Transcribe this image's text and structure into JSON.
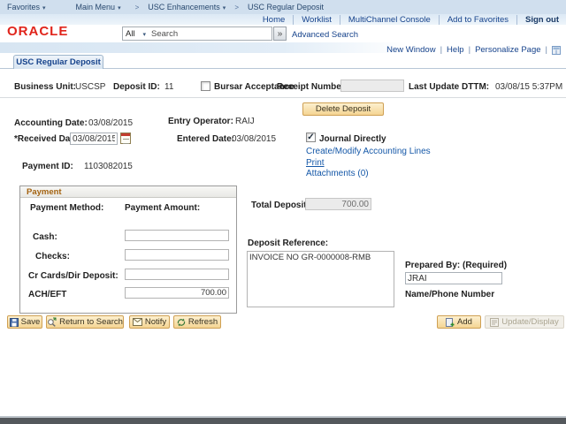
{
  "header": {
    "breadcrumb": {
      "favorites": "Favorites",
      "main_menu": "Main Menu",
      "separator": ">",
      "usc_enhancements": "USC Enhancements",
      "current": "USC Regular Deposit"
    },
    "nav_links": {
      "home": "Home",
      "worklist": "Worklist",
      "multichannel_console": "MultiChannel Console",
      "add_to_favorites": "Add to Favorites",
      "sign_out": "Sign out"
    },
    "logo_text": "ORACLE",
    "search": {
      "scope": "All",
      "placeholder": "Search",
      "advanced_label": "Advanced Search"
    },
    "page_links": {
      "new_window": "New Window",
      "help": "Help",
      "personalize_page": "Personalize Page"
    }
  },
  "tab_label": "USC Regular Deposit",
  "record": {
    "business_unit_label": "Business Unit:",
    "business_unit": "USCSP",
    "deposit_id_label": "Deposit ID:",
    "deposit_id": "11",
    "bursar_acceptance_label": "Bursar Acceptance",
    "bursar_acceptance_checked": false,
    "receipt_number_label": "Receipt Number",
    "receipt_number": "",
    "last_update_label": "Last Update DTTM:",
    "last_update": "03/08/15 5:37PM",
    "accounting_date_label": "Accounting Date:",
    "accounting_date": "03/08/2015",
    "entry_operator_label": "Entry Operator:",
    "entry_operator": "RAIJ",
    "received_date_label": "*Received Date:",
    "received_date": "03/08/2015",
    "entered_date_label": "Entered Date:",
    "entered_date": "03/08/2015",
    "payment_id_label": "Payment ID:",
    "payment_id": "1103082015",
    "journal_directly_label": "Journal Directly",
    "journal_directly_checked": true
  },
  "links": {
    "create_modify": "Create/Modify Accounting Lines",
    "print": "Print",
    "attachments": "Attachments (0)"
  },
  "buttons": {
    "delete_deposit": "Delete Deposit",
    "save": "Save",
    "return_to_search": "Return to Search",
    "notify": "Notify",
    "refresh": "Refresh",
    "add": "Add",
    "update_display": "Update/Display"
  },
  "payment": {
    "title": "Payment",
    "method_header": "Payment Method:",
    "amount_header": "Payment Amount:",
    "rows": [
      {
        "label": "Cash:",
        "value": ""
      },
      {
        "label": "Checks:",
        "value": ""
      },
      {
        "label": "Cr Cards/Dir Deposit:",
        "value": ""
      },
      {
        "label": "ACH/EFT",
        "value": "700.00"
      }
    ]
  },
  "totals": {
    "total_deposit_label": "Total Deposit:",
    "total_deposit": "700.00"
  },
  "deposit_reference": {
    "label": "Deposit Reference:",
    "value": "INVOICE NO GR-0000008-RMB"
  },
  "prepared_by": {
    "label": "Prepared By: (Required)",
    "value": "JRAI",
    "hint": "Name/Phone Number"
  },
  "colors": {
    "oracle_red": "#e0251c",
    "header_link_blue": "#15428b",
    "content_link_blue": "#1558a8",
    "button_border_tan": "#cfa053",
    "group_title_brown": "#a36210",
    "breadcrumb_bg": "#d0dfee",
    "bottom_bar": "#54585c"
  }
}
